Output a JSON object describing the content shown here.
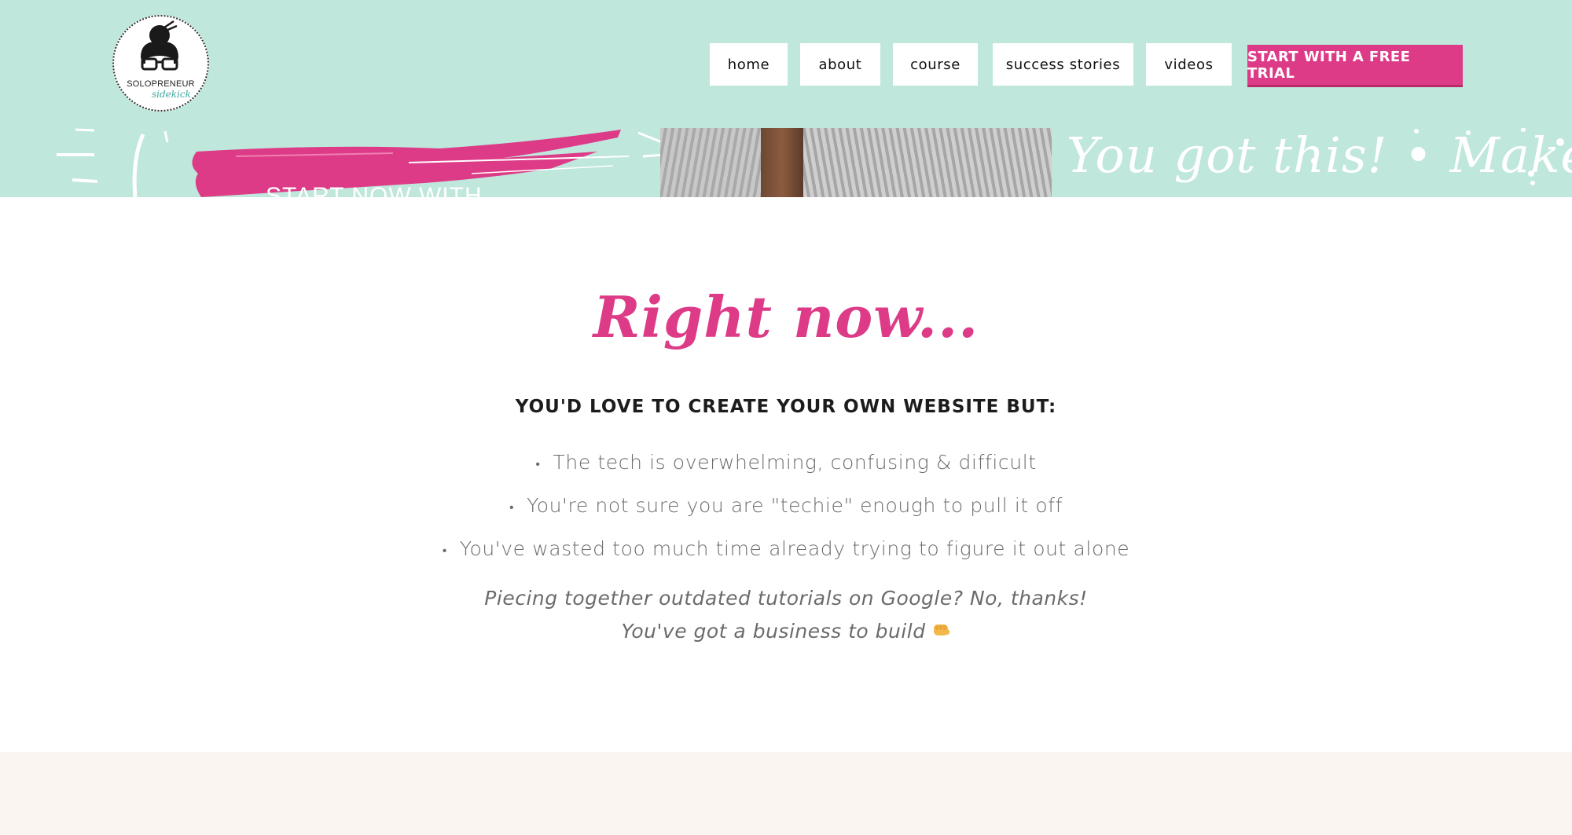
{
  "logo": {
    "name": "SOLOPRENEUR",
    "tagline": "sidekick"
  },
  "nav": {
    "items": [
      {
        "label": "home"
      },
      {
        "label": "about"
      },
      {
        "label": "course"
      },
      {
        "label": "success stories"
      },
      {
        "label": "videos"
      }
    ],
    "cta_label": "START WITH A FREE TRIAL"
  },
  "hero": {
    "pink_text": "START NOW WITH",
    "script_text": "You got this! • Make your"
  },
  "main": {
    "headline": "Right now...",
    "subhead": "YOU'D LOVE TO CREATE YOUR OWN WEBSITE BUT:",
    "bullets": [
      {
        "text": "The tech is overwhelming, confusing & difficult"
      },
      {
        "text": "You're not sure you are \"techie\" enough to pull it off"
      },
      {
        "text": "You've wasted too much time already trying to figure it out alone"
      }
    ],
    "quote_line1": "Piecing together outdated tutorials on Google? No, thanks!",
    "quote_line2": "You've got a business to build",
    "quote_icon": "fist-bump-icon"
  },
  "colors": {
    "header_bg": "#bfe7dc",
    "accent_pink": "#dd3b87",
    "footer_band": "#fbf5f2"
  }
}
